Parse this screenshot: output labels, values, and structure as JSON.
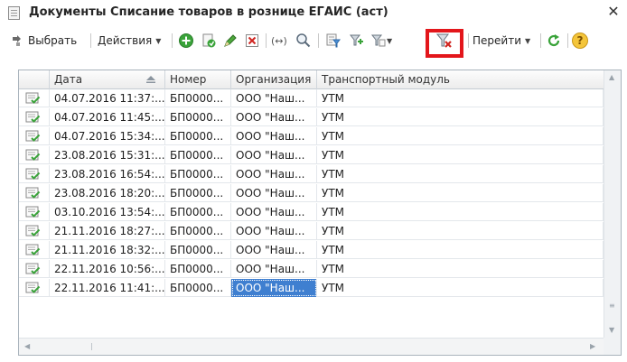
{
  "window": {
    "title": "Документы Списание товаров в рознице ЕГАИС (аст)",
    "close_glyph": "✕"
  },
  "toolbar": {
    "select_label": "Выбрать",
    "actions_label": "Действия",
    "navigate_label": "Перейти",
    "dropdown_arrow": "▼",
    "icons": [
      "select-icon",
      "add-icon",
      "copy-icon",
      "edit-icon",
      "delete-icon",
      "hierarchy-icon",
      "search-icon",
      "filter-selection-icon",
      "filter-by-value-icon",
      "filter-history-icon",
      "clear-filter-icon",
      "refresh-icon",
      "help-icon"
    ],
    "help_glyph": "?",
    "hierarchy_glyph": "(↔)"
  },
  "colors": {
    "highlight": "#e3161b",
    "selection": "#3f7fd0",
    "green_icon": "#3aa33a"
  },
  "grid": {
    "columns": [
      "Дата",
      "Номер",
      "Организация",
      "Транспортный модуль"
    ],
    "rows": [
      {
        "date": "04.07.2016 11:37:...",
        "number": "БП0000...",
        "org": "ООО \"Наш...",
        "module": "УТМ"
      },
      {
        "date": "04.07.2016 11:45:...",
        "number": "БП0000...",
        "org": "ООО \"Наш...",
        "module": "УТМ"
      },
      {
        "date": "04.07.2016 15:34:...",
        "number": "БП0000...",
        "org": "ООО \"Наш...",
        "module": "УТМ"
      },
      {
        "date": "23.08.2016 15:31:...",
        "number": "БП0000...",
        "org": "ООО \"Наш...",
        "module": "УТМ"
      },
      {
        "date": "23.08.2016 16:54:...",
        "number": "БП0000...",
        "org": "ООО \"Наш...",
        "module": "УТМ"
      },
      {
        "date": "23.08.2016 18:20:...",
        "number": "БП0000...",
        "org": "ООО \"Наш...",
        "module": "УТМ"
      },
      {
        "date": "03.10.2016 13:54:...",
        "number": "БП0000...",
        "org": "ООО \"Наш...",
        "module": "УТМ"
      },
      {
        "date": "21.11.2016 18:27:...",
        "number": "БП0000...",
        "org": "ООО \"Наш...",
        "module": "УТМ"
      },
      {
        "date": "21.11.2016 18:32:...",
        "number": "БП0000...",
        "org": "ООО \"Наш...",
        "module": "УТМ"
      },
      {
        "date": "22.11.2016 10:56:...",
        "number": "БП0000...",
        "org": "ООО \"Наш...",
        "module": "УТМ"
      },
      {
        "date": "22.11.2016 11:41:...",
        "number": "БП0000...",
        "org": "ООО \"Наш...",
        "module": "УТМ"
      }
    ],
    "selected_row": 10,
    "selected_column": "org"
  }
}
